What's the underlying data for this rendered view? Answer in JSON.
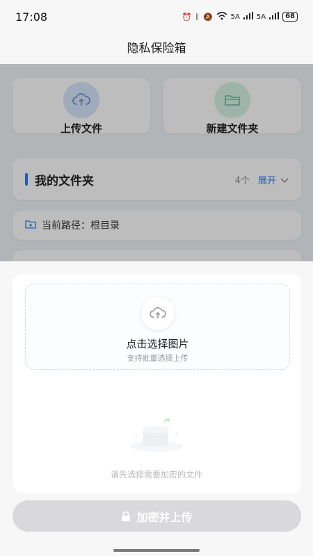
{
  "status_bar": {
    "time": "17:08",
    "network_1": "5A",
    "network_2": "5A",
    "battery": "68"
  },
  "title": "隐私保险箱",
  "actions": {
    "upload_label": "上传文件",
    "new_folder_label": "新建文件夹"
  },
  "folders": {
    "title": "我的文件夹",
    "count": "4个",
    "expand_label": "展开"
  },
  "path": {
    "text": "当前路径：根目录"
  },
  "picker": {
    "title": "点击选择图片",
    "subtitle": "支持批量选择上传"
  },
  "empty_state": {
    "text": "请先选择需要加密的文件"
  },
  "upload_button": {
    "label": "加密并上传"
  },
  "colors": {
    "accent": "#2f7bf0",
    "disabled_button": "#d9d9db"
  }
}
